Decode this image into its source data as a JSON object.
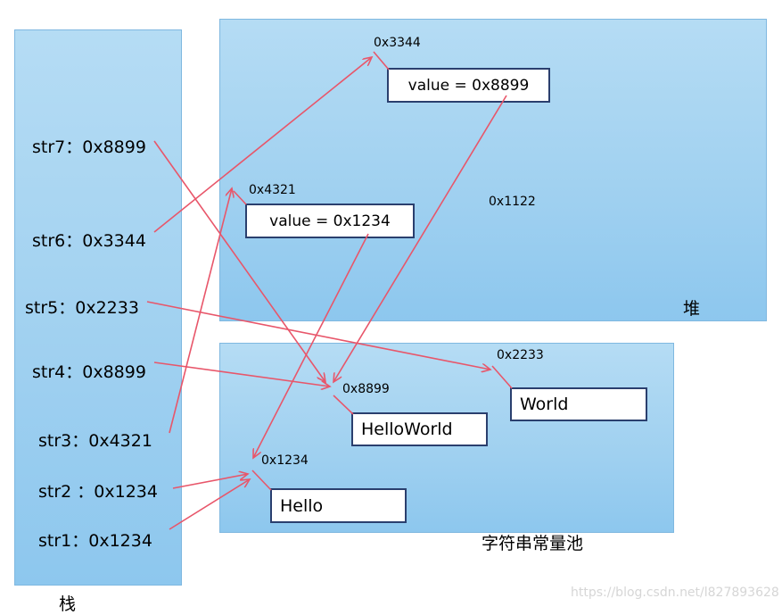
{
  "stack": {
    "title": "栈",
    "vars": [
      {
        "name": "str7",
        "label": "str7：0x8899"
      },
      {
        "name": "str6",
        "label": "str6：0x3344"
      },
      {
        "name": "str5",
        "label": "str5：0x2233"
      },
      {
        "name": "str4",
        "label": "str4：0x8899"
      },
      {
        "name": "str3",
        "label": "str3：0x4321"
      },
      {
        "name": "str2",
        "label": "str2 ：0x1234"
      },
      {
        "name": "str1",
        "label": "str1：0x1234"
      }
    ]
  },
  "heap": {
    "title": "堆",
    "address_label": "0x1122",
    "objects": [
      {
        "addr": "0x3344",
        "value": "value = 0x8899"
      },
      {
        "addr": "0x4321",
        "value": "value = 0x1234"
      }
    ]
  },
  "pool": {
    "title": "字符串常量池",
    "strings": [
      {
        "addr": "0x2233",
        "value": "World"
      },
      {
        "addr": "0x8899",
        "value": "HelloWorld"
      },
      {
        "addr": "0x1234",
        "value": "Hello"
      }
    ]
  },
  "watermark": "https://blog.csdn.net/l827893628",
  "colors": {
    "region_fill": "#a8d6f2",
    "box_border": "#2a3f6e",
    "arrow": "#e8566a"
  }
}
